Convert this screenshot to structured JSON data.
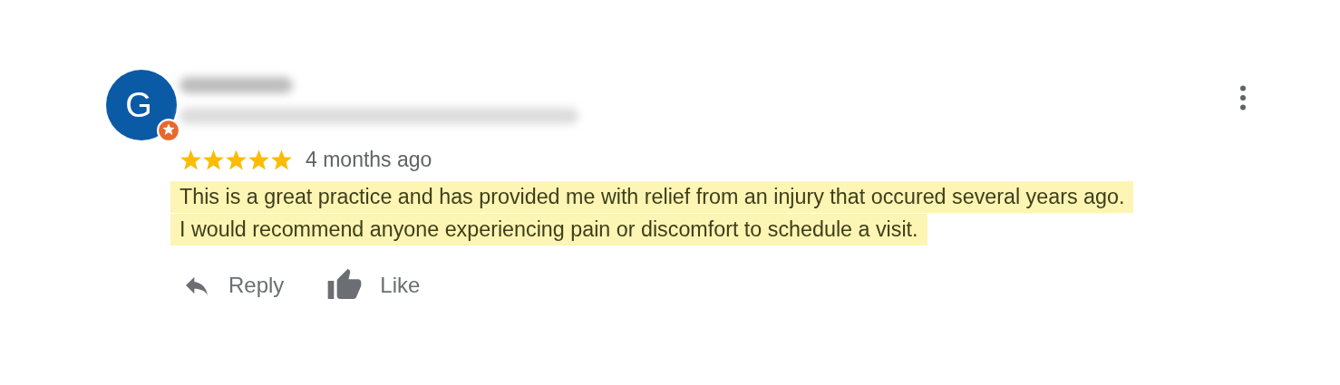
{
  "review": {
    "avatar_letter": "G",
    "stars": 5,
    "time": "4 months ago",
    "text_lines": [
      "This is a great practice and has provided me with relief from an injury that occured several years ago.",
      "I would recommend anyone experiencing pain or discomfort to schedule a visit."
    ]
  },
  "actions": [
    {
      "kind": "reply",
      "label": "Reply"
    },
    {
      "kind": "like",
      "label": "Like"
    }
  ]
}
